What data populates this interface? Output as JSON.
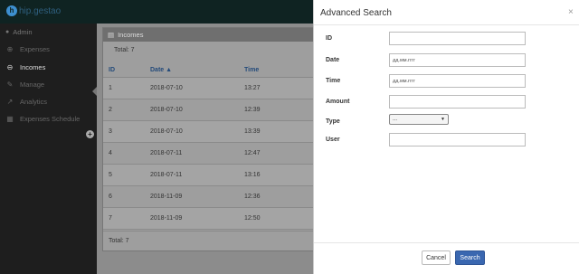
{
  "brand": {
    "logo_letter": "h",
    "name": "hip.gestao"
  },
  "sidebar": {
    "user": "Admin",
    "items": [
      {
        "label": "Expenses",
        "icon": "plus-circle-icon",
        "glyph": "⊕"
      },
      {
        "label": "Incomes",
        "icon": "minus-circle-icon",
        "glyph": "⊖"
      },
      {
        "label": "Manage",
        "icon": "wrench-icon",
        "glyph": "✎"
      },
      {
        "label": "Analytics",
        "icon": "chart-icon",
        "glyph": "↗"
      },
      {
        "label": "Expenses Schedule",
        "icon": "calendar-icon",
        "glyph": "▦"
      }
    ],
    "add_glyph": "+"
  },
  "panel": {
    "title": "Incomes",
    "title_icon": "▤",
    "total_top": "Total: 7",
    "columns": {
      "id": "ID",
      "date": "Date ▲",
      "time": "Time"
    },
    "rows": [
      {
        "id": "1",
        "date": "2018-07-10",
        "time": "13:27"
      },
      {
        "id": "2",
        "date": "2018-07-10",
        "time": "12:39"
      },
      {
        "id": "3",
        "date": "2018-07-10",
        "time": "13:39"
      },
      {
        "id": "4",
        "date": "2018-07-11",
        "time": "12:47"
      },
      {
        "id": "5",
        "date": "2018-07-11",
        "time": "13:16"
      },
      {
        "id": "6",
        "date": "2018-11-09",
        "time": "12:36"
      },
      {
        "id": "7",
        "date": "2018-11-09",
        "time": "12:50"
      }
    ],
    "total_bottom": "Total: 7"
  },
  "modal": {
    "title": "Advanced Search",
    "close": "×",
    "fields": {
      "id_label": "ID",
      "date_label": "Date",
      "date_placeholder": "дд.мм.гггг",
      "time_label": "Time",
      "time_placeholder": "дд.мм.гггг",
      "amount_label": "Amount",
      "type_label": "Type",
      "type_value": "...",
      "type_caret": "▼",
      "user_label": "User"
    },
    "cancel_label": "Cancel",
    "search_label": "Search"
  },
  "colors": {
    "topbar": "#0f2322",
    "sidebar": "#1e1e1e",
    "primary": "#3a67b0"
  }
}
